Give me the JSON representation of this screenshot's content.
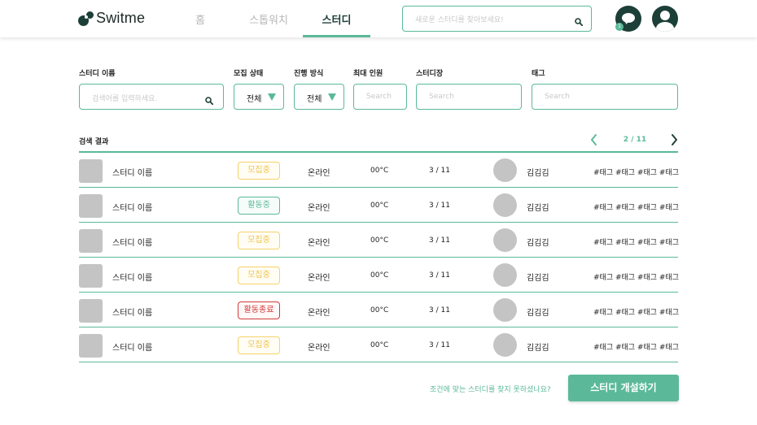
{
  "header": {
    "logo_text": "Switme",
    "nav": {
      "home": "홈",
      "stopwatch": "스톱워치",
      "study": "스터디"
    },
    "search_placeholder": "새로운 스터디를 찾아보세요!",
    "chat_badge": "1"
  },
  "filters": {
    "name_label": "스터디 이름",
    "name_placeholder": "검색어를 입력하세요.",
    "status_label": "모집 상태",
    "status_value": "전체",
    "mode_label": "진행 방식",
    "mode_value": "전체",
    "max_label": "최대 인원",
    "max_placeholder": "Search",
    "leader_label": "스터디장",
    "leader_placeholder": "Search",
    "tag_label": "태그",
    "tag_placeholder": "Search"
  },
  "results": {
    "label": "검색 결과",
    "page": "2 / 11",
    "rows": [
      {
        "name": "스터디 이름",
        "status": "모집중",
        "mode": "온라인",
        "temp": "00°C",
        "count": "3 / 11",
        "leader": "김김김",
        "tags": "#태그 #태그 #태그 #태그"
      },
      {
        "name": "스터디 이름",
        "status": "활동중",
        "mode": "온라인",
        "temp": "00°C",
        "count": "3 / 11",
        "leader": "김김김",
        "tags": "#태그 #태그 #태그 #태그"
      },
      {
        "name": "스터디 이름",
        "status": "모집중",
        "mode": "온라인",
        "temp": "00°C",
        "count": "3 / 11",
        "leader": "김김김",
        "tags": "#태그 #태그 #태그 #태그"
      },
      {
        "name": "스터디 이름",
        "status": "모집중",
        "mode": "온라인",
        "temp": "00°C",
        "count": "3 / 11",
        "leader": "김김김",
        "tags": "#태그 #태그 #태그 #태그"
      },
      {
        "name": "스터디 이름",
        "status": "활동종료",
        "mode": "온라인",
        "temp": "00°C",
        "count": "3 / 11",
        "leader": "김김김",
        "tags": "#태그 #태그 #태그 #태그"
      },
      {
        "name": "스터디 이름",
        "status": "모집중",
        "mode": "온라인",
        "temp": "00°C",
        "count": "3 / 11",
        "leader": "김김김",
        "tags": "#태그 #태그 #태그 #태그"
      }
    ]
  },
  "footer": {
    "not_found_text": "조건에 맞는 스터디를 찾지 못하셨나요?",
    "create_label": "스터디 개설하기"
  },
  "colors": {
    "accent": "#5bb99a",
    "dark": "#1c3f37",
    "recruit": "#f0c24a",
    "ended": "#d33a3a"
  }
}
